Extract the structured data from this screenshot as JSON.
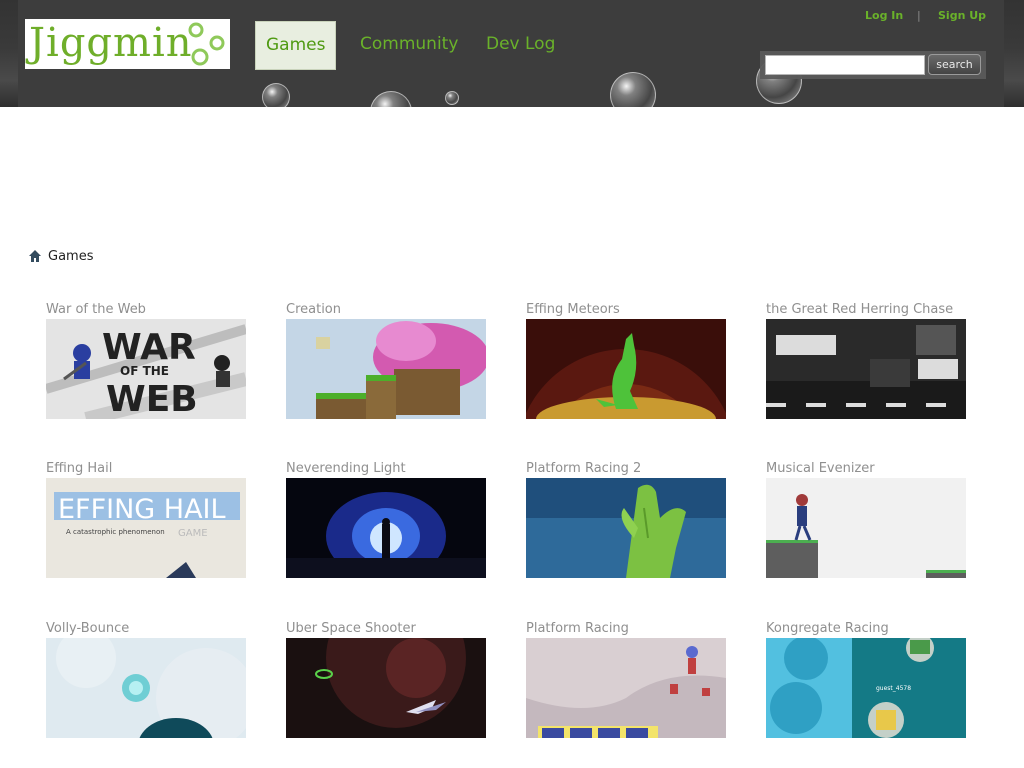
{
  "header": {
    "logo_text": "Jiggmin",
    "nav": [
      {
        "label": "Games",
        "active": true
      },
      {
        "label": "Community",
        "active": false
      },
      {
        "label": "Dev Log",
        "active": false
      }
    ],
    "login_label": "Log In",
    "separator": "|",
    "signup_label": "Sign Up",
    "search": {
      "value": "",
      "placeholder": "",
      "button_label": "search"
    }
  },
  "breadcrumb": {
    "icon": "home-icon",
    "label": "Games"
  },
  "games": [
    {
      "title": "War of the Web"
    },
    {
      "title": "Creation"
    },
    {
      "title": "Effing Meteors"
    },
    {
      "title": "the Great Red Herring Chase"
    },
    {
      "title": "Effing Hail"
    },
    {
      "title": "Neverending Light"
    },
    {
      "title": "Platform Racing 2"
    },
    {
      "title": "Musical Evenizer"
    },
    {
      "title": "Volly-Bounce"
    },
    {
      "title": "Uber Space Shooter"
    },
    {
      "title": "Platform Racing"
    },
    {
      "title": "Kongregate Racing"
    }
  ],
  "thumb_text": {
    "war_of_the_web": [
      "WAR",
      "OF THE",
      "WEB"
    ],
    "effing_hail": [
      "EFFING HAIL",
      "A catastrophic phenomenon",
      "GAME"
    ],
    "kongregate_guest": "guest_4578"
  },
  "colors": {
    "accent": "#6ab22a",
    "header_bg": "#3d3d3d",
    "title_gray": "#8f8f8f"
  }
}
